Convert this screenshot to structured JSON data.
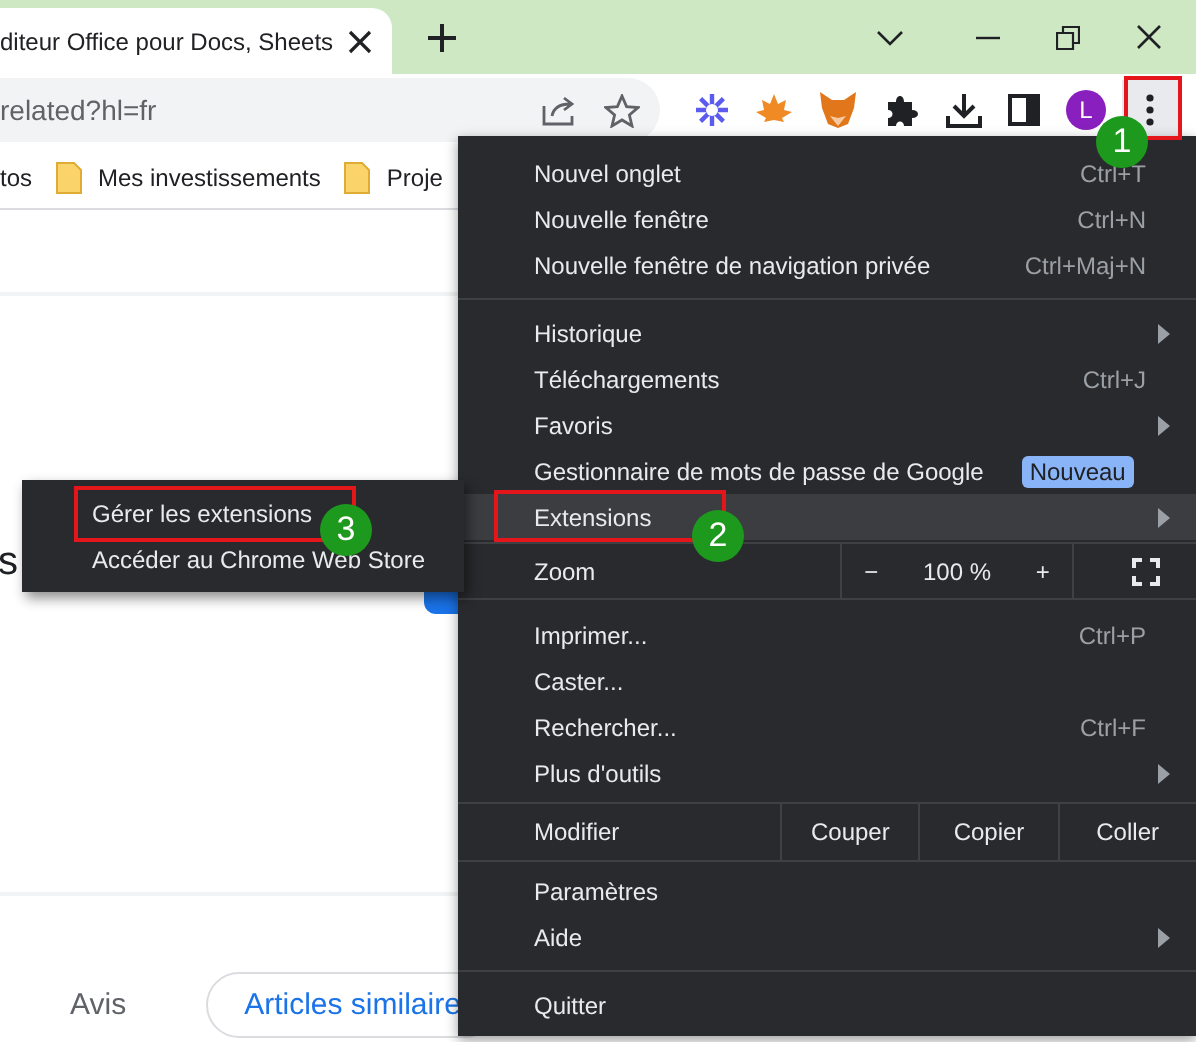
{
  "tab": {
    "title": "diteur Office pour Docs, Sheets"
  },
  "address_bar": {
    "url": "related?hl=fr"
  },
  "avatar": "L",
  "bookmarks": [
    {
      "label": "tos",
      "kind": "text"
    },
    {
      "label": "Mes investissements",
      "kind": "folder"
    },
    {
      "label": "Proje",
      "kind": "folder"
    }
  ],
  "page": {
    "heading": "s",
    "tabs": [
      {
        "label": "Avis",
        "selected": false
      },
      {
        "label": "Articles similaire",
        "selected": true
      }
    ]
  },
  "menu": {
    "items": [
      {
        "kind": "item",
        "label": "Nouvel onglet",
        "shortcut": "Ctrl+T",
        "submenu": false,
        "selected": false
      },
      {
        "kind": "item",
        "label": "Nouvelle fenêtre",
        "shortcut": "Ctrl+N",
        "submenu": false,
        "selected": false
      },
      {
        "kind": "item",
        "label": "Nouvelle fenêtre de navigation privée",
        "shortcut": "Ctrl+Maj+N",
        "submenu": false,
        "selected": false
      },
      {
        "kind": "separator"
      },
      {
        "kind": "item",
        "label": "Historique",
        "submenu": true,
        "selected": false
      },
      {
        "kind": "item",
        "label": "Téléchargements",
        "shortcut": "Ctrl+J",
        "submenu": false,
        "selected": false
      },
      {
        "kind": "item",
        "label": "Favoris",
        "submenu": true,
        "selected": false
      },
      {
        "kind": "item",
        "label": "Gestionnaire de mots de passe de Google",
        "badge": "Nouveau",
        "submenu": false,
        "selected": false
      },
      {
        "kind": "item",
        "label": "Extensions",
        "submenu": true,
        "selected": true
      },
      {
        "kind": "zoom",
        "label": "Zoom",
        "minus": "−",
        "level_text": "100 %",
        "plus": "+"
      },
      {
        "kind": "item",
        "label": "Imprimer...",
        "shortcut": "Ctrl+P",
        "submenu": false,
        "selected": false
      },
      {
        "kind": "item",
        "label": "Caster...",
        "submenu": false,
        "selected": false
      },
      {
        "kind": "item",
        "label": "Rechercher...",
        "shortcut": "Ctrl+F",
        "submenu": false,
        "selected": false
      },
      {
        "kind": "item",
        "label": "Plus d'outils",
        "submenu": true,
        "selected": false
      },
      {
        "kind": "edit",
        "label": "Modifier",
        "buttons": [
          "Couper",
          "Copier",
          "Coller"
        ]
      },
      {
        "kind": "item",
        "label": "Paramètres",
        "submenu": false,
        "selected": false
      },
      {
        "kind": "item",
        "label": "Aide",
        "submenu": true,
        "selected": false
      },
      {
        "kind": "separator"
      },
      {
        "kind": "item",
        "label": "Quitter",
        "submenu": false,
        "selected": false
      }
    ]
  },
  "submenu": {
    "items": [
      {
        "label": "Gérer les extensions"
      },
      {
        "label": "Accéder au Chrome Web Store"
      }
    ]
  },
  "annotations": [
    {
      "number": "1"
    },
    {
      "number": "2"
    },
    {
      "number": "3"
    }
  ]
}
